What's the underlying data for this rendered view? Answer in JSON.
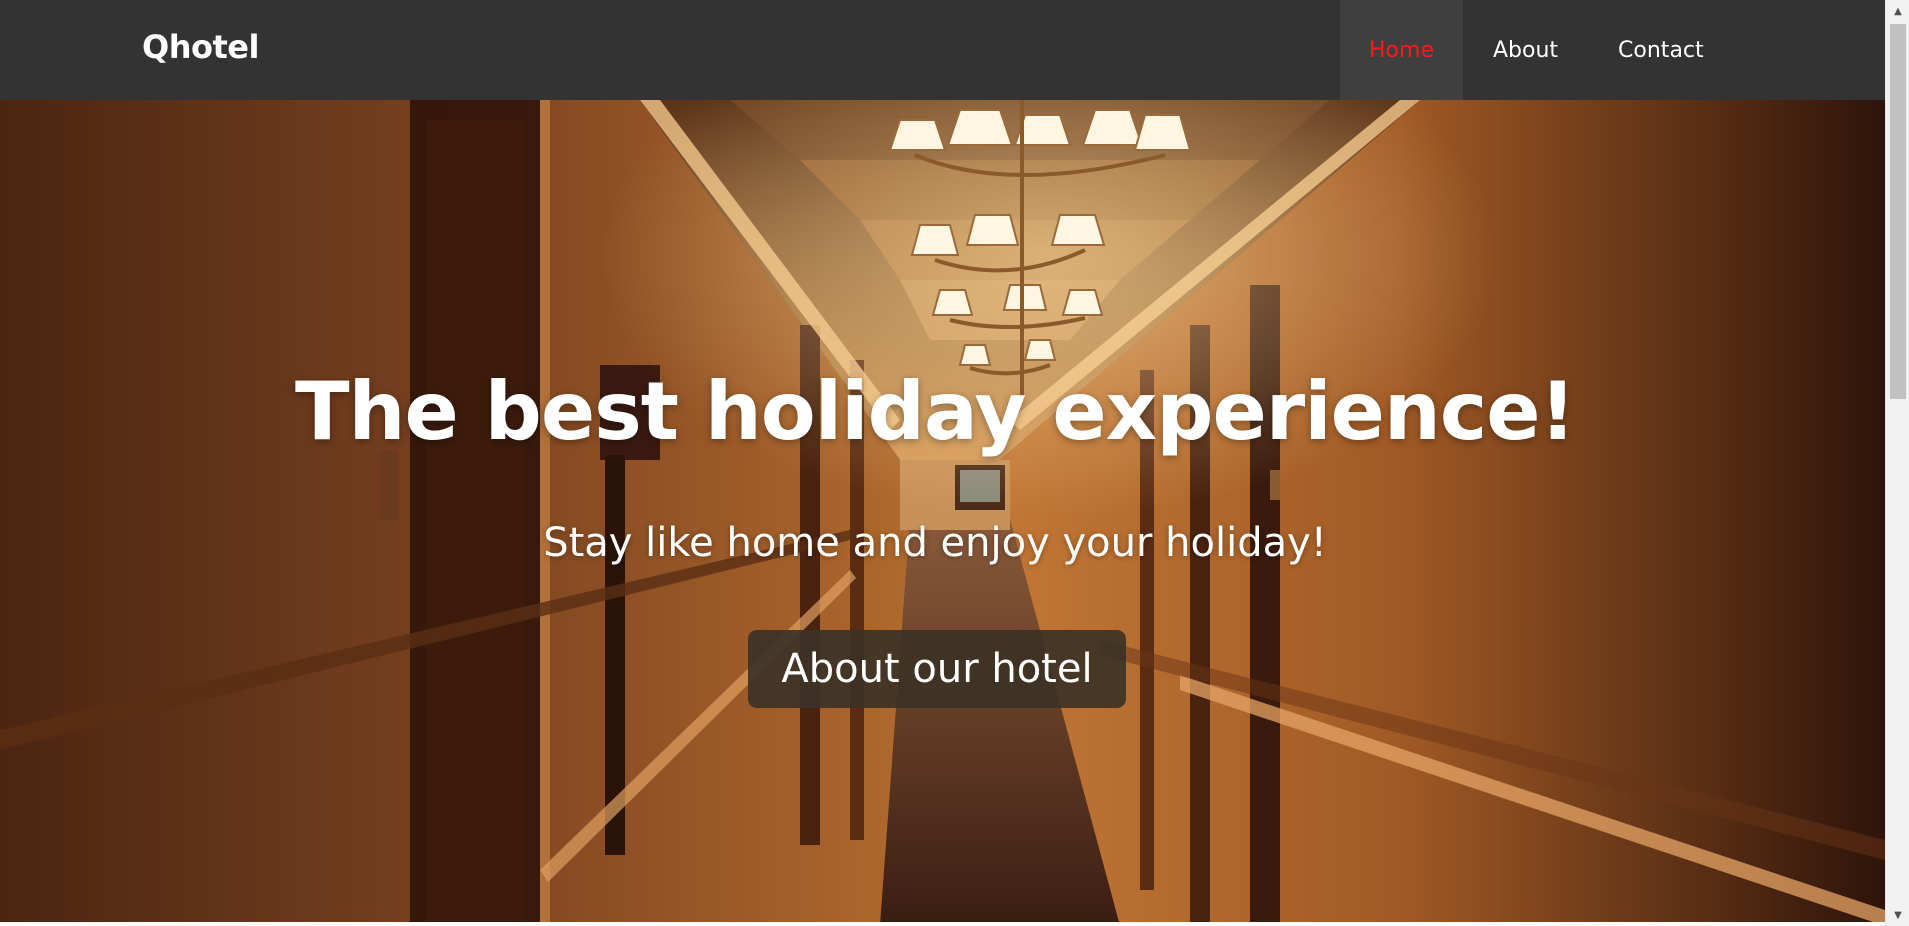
{
  "navbar": {
    "brand": "Qhotel",
    "links": [
      {
        "label": "Home",
        "active": true
      },
      {
        "label": "About",
        "active": false
      },
      {
        "label": "Contact",
        "active": false
      }
    ],
    "background": "#333333",
    "active_color": "#ff1a1a"
  },
  "hero": {
    "title": "The best holiday experience!",
    "subtitle": "Stay like home and enjoy your holiday!",
    "button_label": "About our hotel",
    "background_image": "hotel-corridor-with-chandeliers"
  },
  "scrollbar": {
    "up_icon": "chevron-up-icon",
    "down_icon": "chevron-down-icon"
  }
}
